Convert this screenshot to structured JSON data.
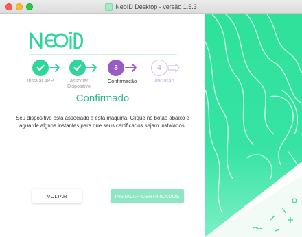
{
  "window": {
    "title": "NeoID Desktop - versão 1.5.3"
  },
  "brand": {
    "logo_text": "NEOID"
  },
  "steps": [
    {
      "label": "Instalar APP",
      "state": "done"
    },
    {
      "label": "Associar Dispositivo",
      "state": "done"
    },
    {
      "number": "3",
      "label": "Confirmação",
      "state": "active"
    },
    {
      "number": "4",
      "label": "Conclusão",
      "state": "pending"
    }
  ],
  "main": {
    "heading": "Confirmado",
    "description": "Seu dispositivo está associado a esta máquina. Clique no botão abaixo e aguarde alguns instantes para que seus certificados sejam instalados."
  },
  "buttons": {
    "back": "VOLTAR",
    "install": "INSTALAR CERTIFICADOS"
  },
  "colors": {
    "accent_green": "#2fd59a",
    "accent_purple": "#9a5ac7",
    "heading_green": "#2db985",
    "button_green": "#8fe6c4"
  }
}
